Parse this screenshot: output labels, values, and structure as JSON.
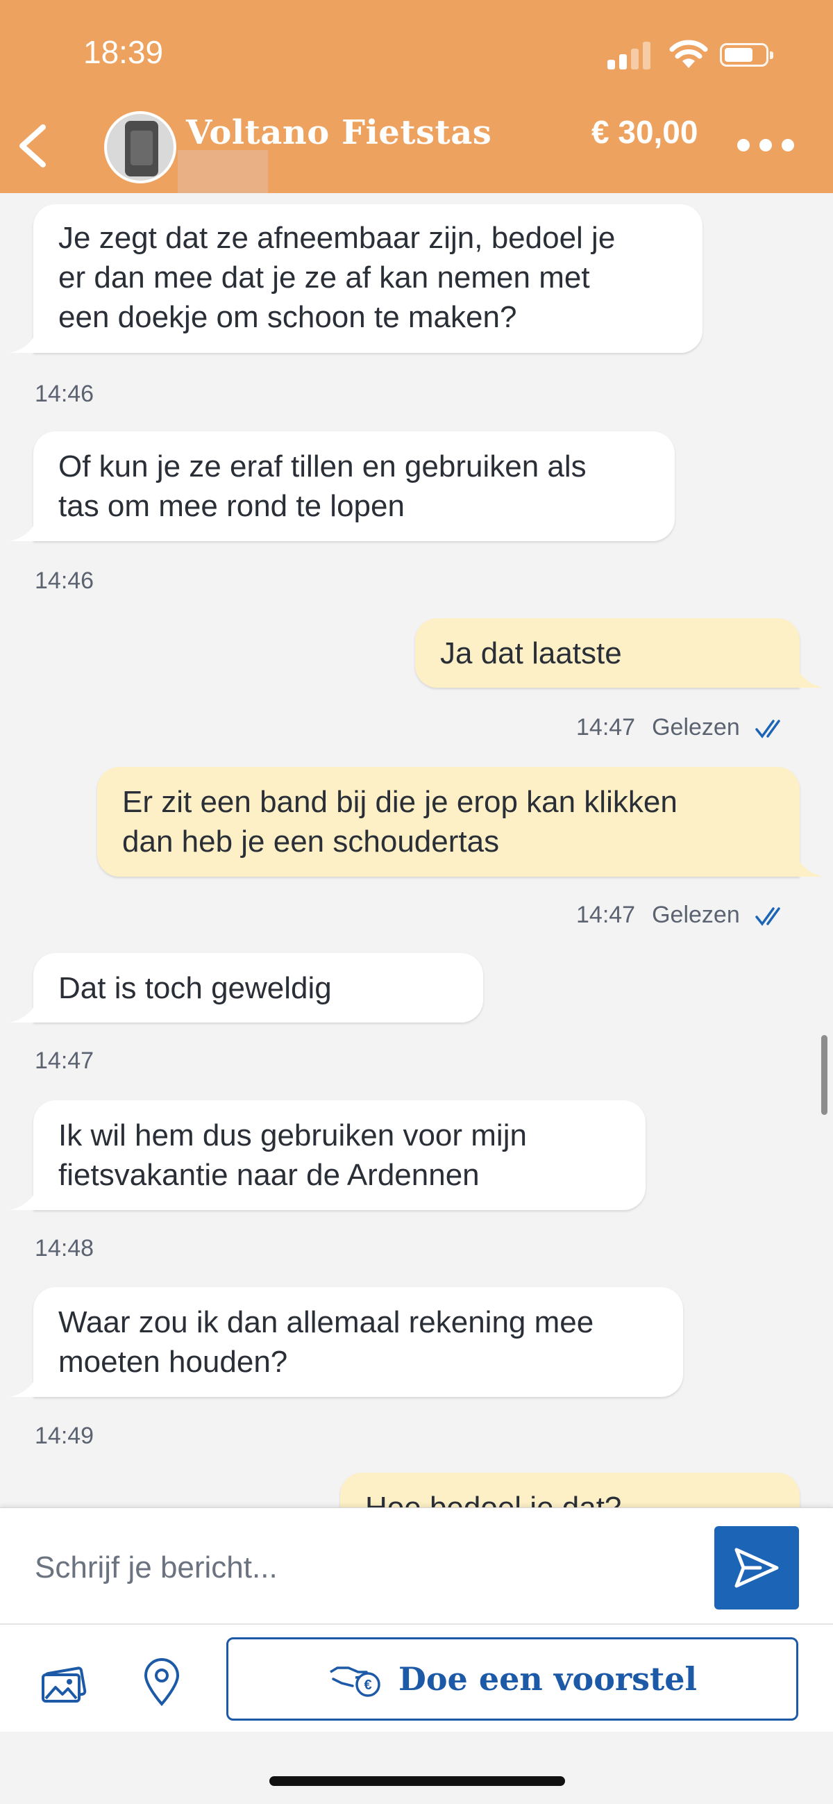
{
  "status_bar": {
    "time": "18:39"
  },
  "header": {
    "title": "Voltano Fietstas",
    "price": "€ 30,00"
  },
  "messages": [
    {
      "direction": "in",
      "text": "Je zegt dat ze afneembaar zijn, bedoel je\ner dan mee dat je ze af kan nemen met\neen doekje om schoon te maken?",
      "time": "14:46"
    },
    {
      "direction": "in",
      "text": "Of kun je ze eraf tillen en gebruiken als\ntas om mee rond te lopen",
      "time": "14:46"
    },
    {
      "direction": "out",
      "text": "Ja dat laatste",
      "time": "14:47",
      "status": "Gelezen"
    },
    {
      "direction": "out",
      "text": "Er zit een band bij die je erop kan klikken\ndan heb je een schoudertas",
      "time": "14:47",
      "status": "Gelezen"
    },
    {
      "direction": "in",
      "text": "Dat is toch geweldig",
      "time": "14:47"
    },
    {
      "direction": "in",
      "text": "Ik wil hem dus gebruiken voor mijn\nfietsvakantie naar de Ardennen",
      "time": "14:48"
    },
    {
      "direction": "in",
      "text": "Waar zou ik dan allemaal rekening mee\nmoeten houden?",
      "time": "14:49"
    },
    {
      "direction": "out",
      "text": "Hoe bedoel je dat?"
    }
  ],
  "composer": {
    "placeholder": "Schrijf je bericht..."
  },
  "toolbar": {
    "offer_label": "Doe een voorstel"
  },
  "colors": {
    "header": "#eea25f",
    "incoming_bubble": "#ffffff",
    "outgoing_bubble": "#fdf0c6",
    "accent_blue": "#1c64b5"
  }
}
